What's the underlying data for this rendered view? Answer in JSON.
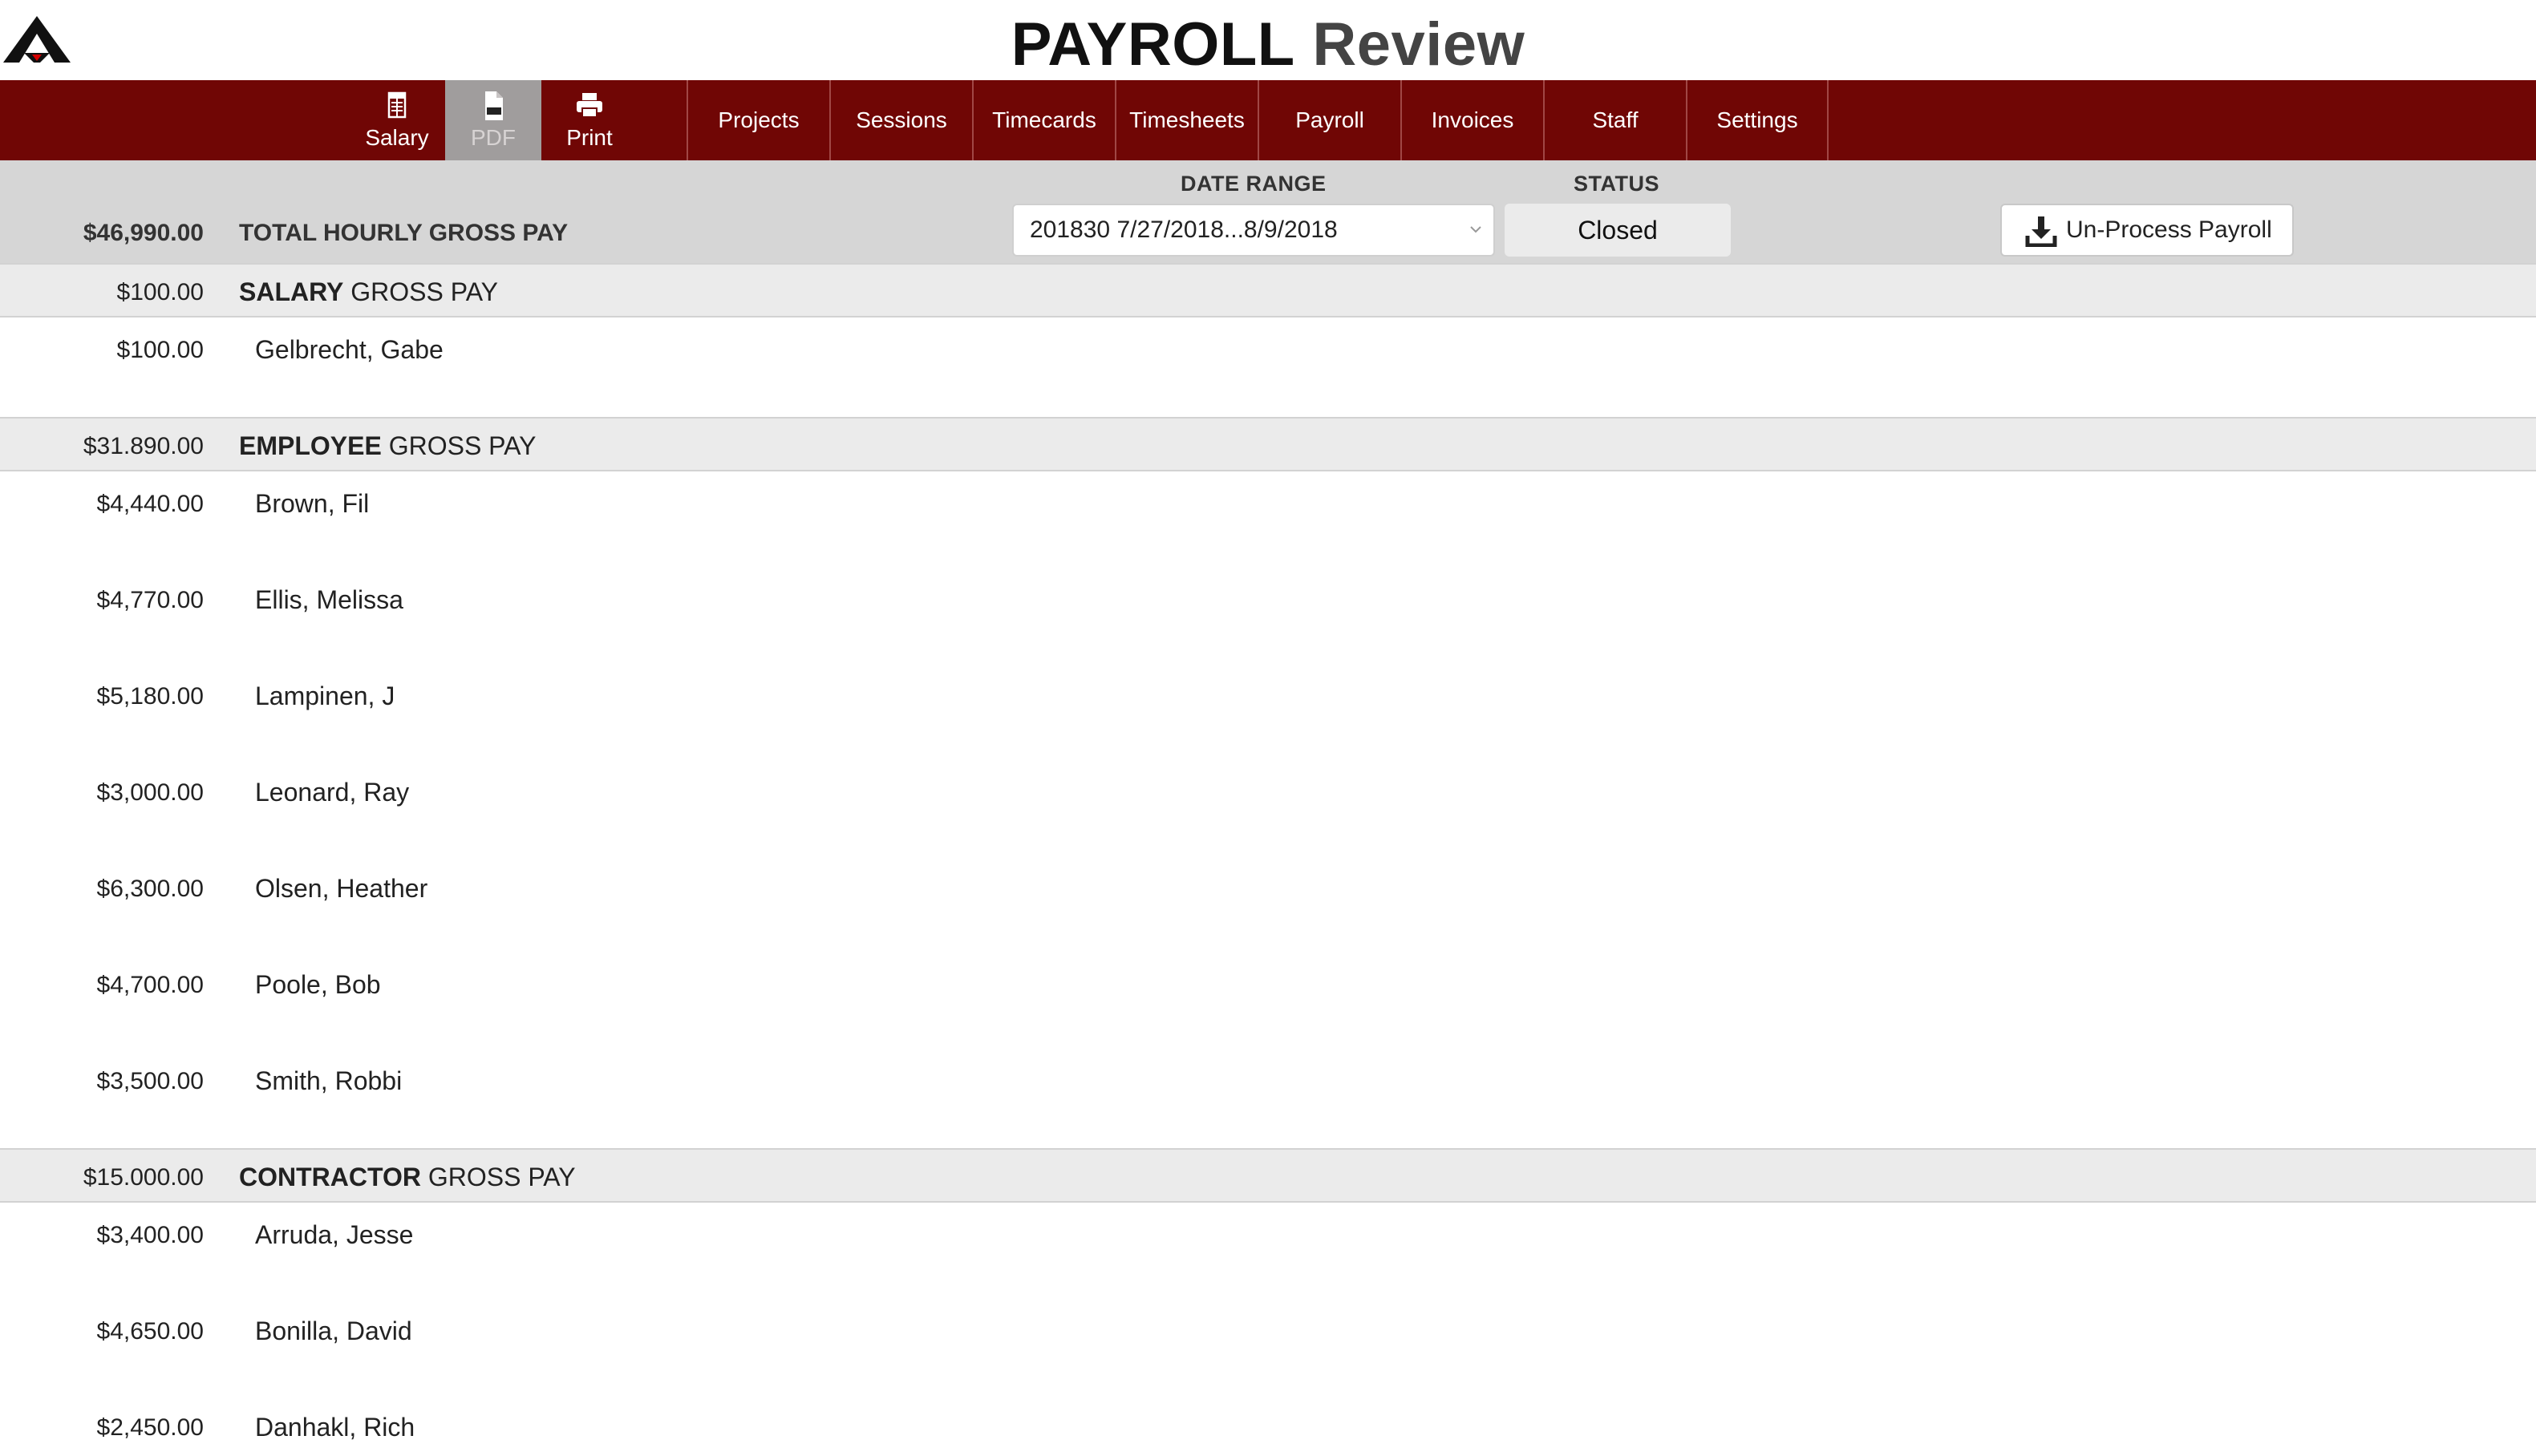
{
  "app": {
    "title_bold": "PAYROLL",
    "title_light": "Review",
    "logo_icon": "app-logo",
    "brand_color": "#700605",
    "logo_accent": "#d40000"
  },
  "toolbar": {
    "salary_label": "Salary",
    "salary_icon": "spreadsheet-icon",
    "pdf_label": "PDF",
    "pdf_icon": "pdf-file-icon",
    "print_label": "Print",
    "print_icon": "printer-icon"
  },
  "nav": {
    "tabs": [
      {
        "label": "Projects"
      },
      {
        "label": "Sessions"
      },
      {
        "label": "Timecards"
      },
      {
        "label": "Timesheets"
      },
      {
        "label": "Payroll"
      },
      {
        "label": "Invoices"
      },
      {
        "label": "Staff"
      },
      {
        "label": "Settings"
      }
    ]
  },
  "filters": {
    "total_amount": "$46,990.00",
    "total_label": "TOTAL HOURLY GROSS PAY",
    "date_range_caption": "DATE RANGE",
    "date_range_value": "201830 7/27/2018...8/9/2018",
    "status_caption": "STATUS",
    "status_value": "Closed",
    "unprocess_label": "Un-Process Payroll",
    "unprocess_icon": "download-icon"
  },
  "sections": {
    "salary": {
      "amount": "$100.00",
      "title_bold": "SALARY",
      "title_rest": "GROSS PAY",
      "rows": [
        {
          "amount": "$100.00",
          "name": "Gelbrecht, Gabe"
        }
      ]
    },
    "employee": {
      "amount": "$31.890.00",
      "title_bold": "EMPLOYEE",
      "title_rest": "GROSS PAY",
      "rows": [
        {
          "amount": "$4,440.00",
          "name": "Brown, Fil"
        },
        {
          "amount": "$4,770.00",
          "name": "Ellis, Melissa"
        },
        {
          "amount": "$5,180.00",
          "name": "Lampinen, J"
        },
        {
          "amount": "$3,000.00",
          "name": "Leonard, Ray"
        },
        {
          "amount": "$6,300.00",
          "name": "Olsen, Heather"
        },
        {
          "amount": "$4,700.00",
          "name": "Poole, Bob"
        },
        {
          "amount": "$3,500.00",
          "name": "Smith, Robbi"
        }
      ]
    },
    "contractor": {
      "amount": "$15.000.00",
      "title_bold": "CONTRACTOR",
      "title_rest": "GROSS PAY",
      "rows": [
        {
          "amount": "$3,400.00",
          "name": "Arruda, Jesse"
        },
        {
          "amount": "$4,650.00",
          "name": "Bonilla, David"
        },
        {
          "amount": "$2,450.00",
          "name": "Danhakl, Rich"
        }
      ]
    }
  }
}
